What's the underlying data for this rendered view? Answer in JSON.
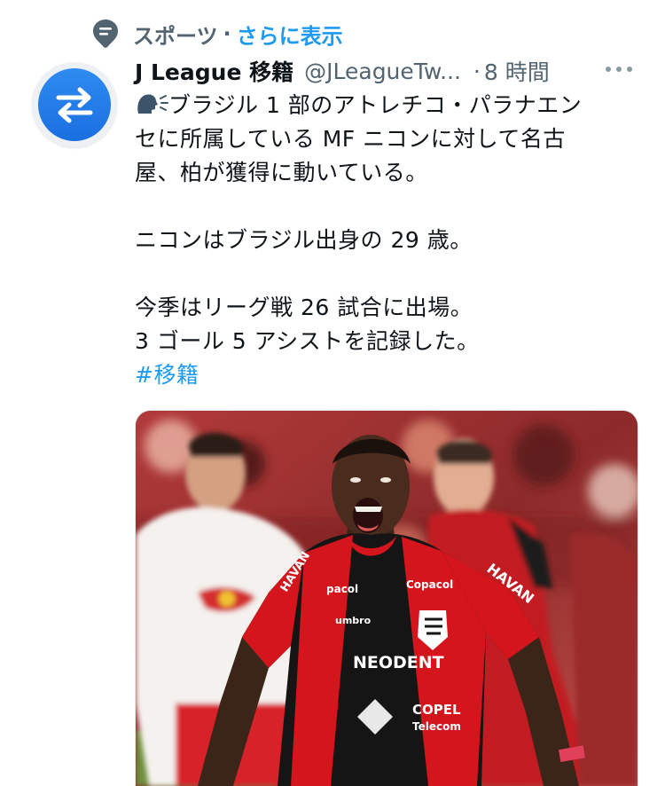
{
  "context": {
    "category": "スポーツ",
    "separator": "·",
    "link_label": "さらに表示"
  },
  "tweet": {
    "display_name": "J League 移籍",
    "handle": "@JLeagueTw...",
    "time_separator": "·",
    "time": "8 時間",
    "avatar_icon": "swap-arrows-icon",
    "lines": [
      "ブラジル 1 部のアトレチコ・パラナエン",
      "セに所属している MF ニコンに対して名古",
      "屋、柏が獲得に動いている。",
      "",
      "ニコンはブラジル出身の 29 歳。",
      "",
      "今季はリーグ戦 26 試合に出場。",
      "3 ゴール 5 アシストを記録した。"
    ],
    "hashtag": "#移籍",
    "photo_texts": {
      "sponsor_sleeve": "HAVAN",
      "sponsor_chest": "NEODENT",
      "sponsor_left": "pacol",
      "sponsor_right": "Copacol",
      "brand": "umbro",
      "sponsor_lower": "COPEL",
      "sponsor_lower2": "Telecom"
    }
  },
  "colors": {
    "accent": "#1d9bf0",
    "secondary_text": "#536471",
    "primary_text": "#0f1419",
    "jersey_red": "#d4151c",
    "jersey_black": "#151515"
  }
}
